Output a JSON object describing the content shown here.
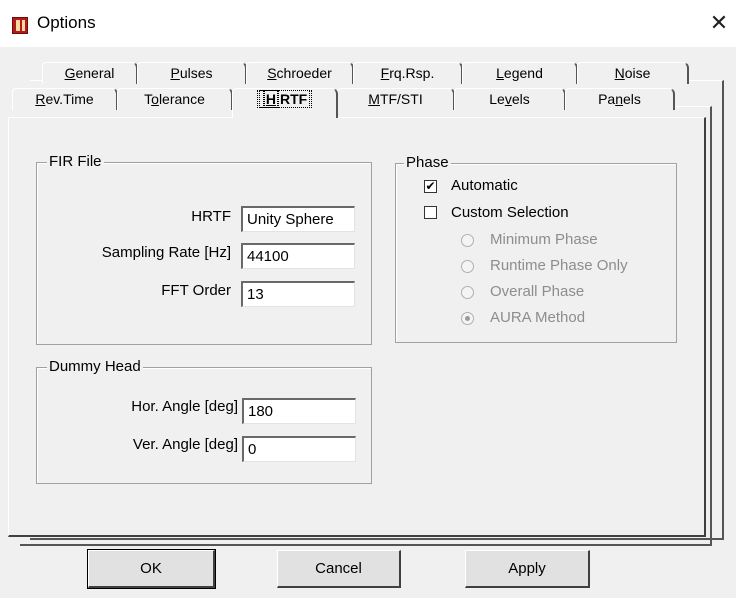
{
  "window": {
    "title": "Options",
    "app_icon": "app-logo-icon",
    "close_glyph": "✕"
  },
  "tabs_row1": [
    {
      "pre": "",
      "u": "G",
      "post": "eneral"
    },
    {
      "pre": "",
      "u": "P",
      "post": "ulses"
    },
    {
      "pre": "",
      "u": "S",
      "post": "chroeder"
    },
    {
      "pre": "",
      "u": "F",
      "post": "rq.Rsp."
    },
    {
      "pre": "",
      "u": "L",
      "post": "egend"
    },
    {
      "pre": "",
      "u": "N",
      "post": "oise"
    }
  ],
  "tabs_row2": [
    {
      "pre": "",
      "u": "R",
      "post": "ev.Time"
    },
    {
      "pre": "T",
      "u": "o",
      "post": "lerance"
    },
    {
      "pre": "",
      "u": "H",
      "post": "RTF",
      "active": true
    },
    {
      "pre": "",
      "u": "M",
      "post": "TF/STI"
    },
    {
      "pre": "Le",
      "u": "v",
      "post": "els"
    },
    {
      "pre": "Pa",
      "u": "n",
      "post": "els"
    }
  ],
  "fir_file": {
    "title": "FIR File",
    "hrtf_label": "HRTF",
    "hrtf_value": "Unity Sphere",
    "rate_label": "Sampling Rate [Hz]",
    "rate_value": "44100",
    "fft_label": "FFT Order",
    "fft_value": "13"
  },
  "dummy_head": {
    "title": "Dummy Head",
    "hor_label": "Hor. Angle [deg]",
    "hor_value": "180",
    "ver_label": "Ver. Angle [deg]",
    "ver_value": "0"
  },
  "phase": {
    "title": "Phase",
    "automatic_label": "Automatic",
    "automatic_checked": true,
    "custom_label": "Custom Selection",
    "custom_checked": false,
    "options": [
      "Minimum Phase",
      "Runtime Phase Only",
      "Overall Phase",
      "AURA Method"
    ],
    "selected_option": "AURA Method",
    "check_glyph": "✔"
  },
  "buttons": {
    "ok": "OK",
    "cancel": "Cancel",
    "apply": "Apply"
  }
}
